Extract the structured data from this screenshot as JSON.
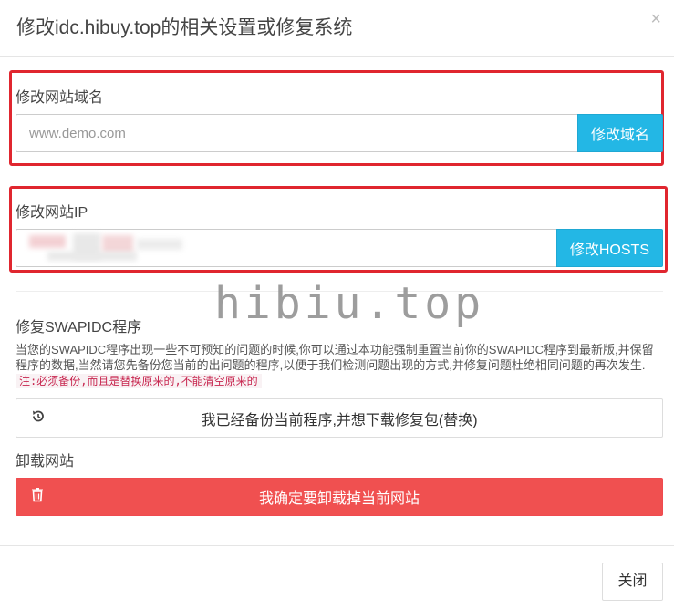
{
  "modal": {
    "title": "修改idc.hibuy.top的相关设置或修复系统",
    "close_symbol": "×"
  },
  "domain_section": {
    "label": "修改网站域名",
    "input_placeholder": "www.demo.com",
    "button_label": "修改域名"
  },
  "ip_section": {
    "label": "修改网站IP",
    "button_label": "修改HOSTS"
  },
  "watermark": "hibiu.top",
  "repair_section": {
    "label": "修复SWAPIDC程序",
    "description": "当您的SWAPIDC程序出现一些不可预知的问题的时候,你可以通过本功能强制重置当前你的SWAPIDC程序到最新版,并保留程序的数据,当然请您先备份您当前的出问题的程序,以便于我们检测问题出现的方式,并修复问题杜绝相同问题的再次发生.",
    "note": "注:必须备份,而且是替换原来的,不能清空原来的",
    "button_label": "我已经备份当前程序,并想下载修复包(替换)",
    "button_icon": "history-icon"
  },
  "uninstall_section": {
    "label": "卸载网站",
    "button_label": "我确定要卸载掉当前网站",
    "button_icon": "trash-icon"
  },
  "footer": {
    "close_label": "关闭"
  },
  "colors": {
    "highlight_border": "#e0262f",
    "info_button": "#23b7e5",
    "danger_button": "#f05050",
    "note_text": "#c7254e"
  }
}
